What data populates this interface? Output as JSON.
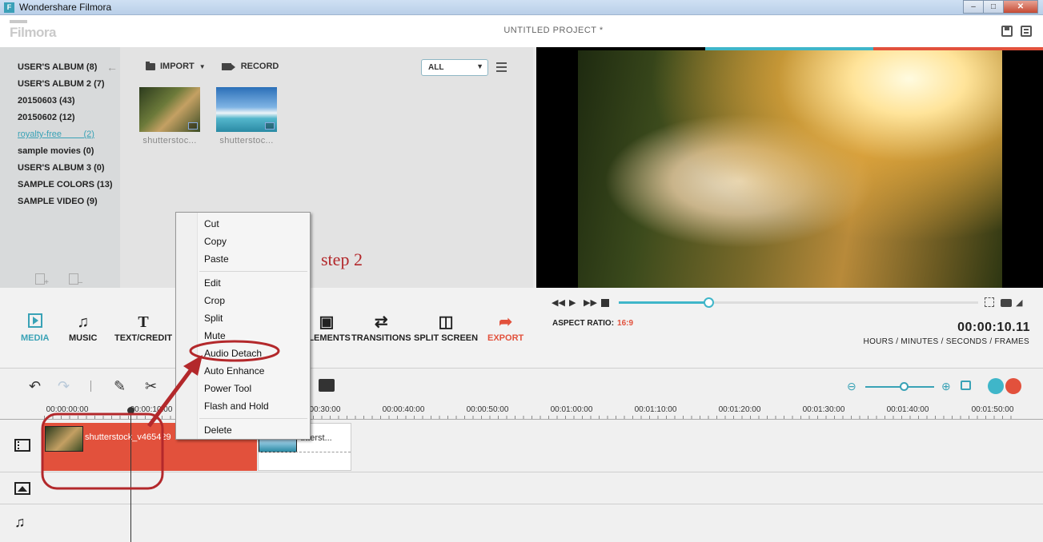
{
  "window": {
    "title": "Wondershare Filmora",
    "app_icon": "F",
    "buttons": [
      "–",
      "□",
      "✕"
    ]
  },
  "header": {
    "logo": "Filmora",
    "project_title": "UNTITLED PROJECT *"
  },
  "albums": [
    {
      "label": "USER'S ALBUM (8)"
    },
    {
      "label": "USER'S ALBUM 2 (7)"
    },
    {
      "label": "20150603 (43)"
    },
    {
      "label": "20150602 (12)"
    },
    {
      "label": "royalty-free         (2)",
      "active": true
    },
    {
      "label": "sample movies (0)"
    },
    {
      "label": "USER'S ALBUM 3 (0)"
    },
    {
      "label": "SAMPLE COLORS (13)"
    },
    {
      "label": "SAMPLE VIDEO (9)"
    }
  ],
  "media": {
    "import_label": "IMPORT",
    "record_label": "RECORD",
    "filter": "ALL",
    "items": [
      {
        "caption": "shutterstoc..."
      },
      {
        "caption": "shutterstoc..."
      }
    ]
  },
  "tabs": [
    {
      "label": "MEDIA",
      "icon": "media-icon"
    },
    {
      "label": "MUSIC",
      "icon": "music-icon"
    },
    {
      "label": "TEXT/CREDIT",
      "icon": "text-icon"
    },
    {
      "label": "ELEMENTS",
      "icon": "elements-icon"
    },
    {
      "label": "TRANSITIONS",
      "icon": "transitions-icon"
    },
    {
      "label": "SPLIT SCREEN",
      "icon": "split-screen-icon"
    },
    {
      "label": "EXPORT",
      "icon": "export-icon"
    }
  ],
  "preview": {
    "aspect_label": "ASPECT RATIO:",
    "aspect_value": "16:9",
    "timecode": "00:00:10.11",
    "time_units": "HOURS / MINUTES / SECONDS / FRAMES",
    "progress": 0.25
  },
  "timeline": {
    "ruler": [
      "00:00:00:00",
      "00:00:10:00",
      "00:00:30:00",
      "00:00:40:00",
      "00:00:50:00",
      "00:01:00:00",
      "00:01:10:00",
      "00:01:20:00",
      "00:01:30:00",
      "00:01:40:00",
      "00:01:50:00"
    ],
    "clip1_label": "shutterstock_v465429",
    "clip2_label": "utterst..."
  },
  "context_menu": [
    "Cut",
    "Copy",
    "Paste",
    "Edit",
    "Crop",
    "Split",
    "Mute",
    "Audio Detach",
    "Auto Enhance",
    "Power Tool",
    "Flash and Hold",
    "Delete"
  ],
  "annotation": {
    "step": "step 2"
  },
  "colors": {
    "accent": "#3fb6c9",
    "export": "#e2513c",
    "annotation": "#b3282b"
  }
}
